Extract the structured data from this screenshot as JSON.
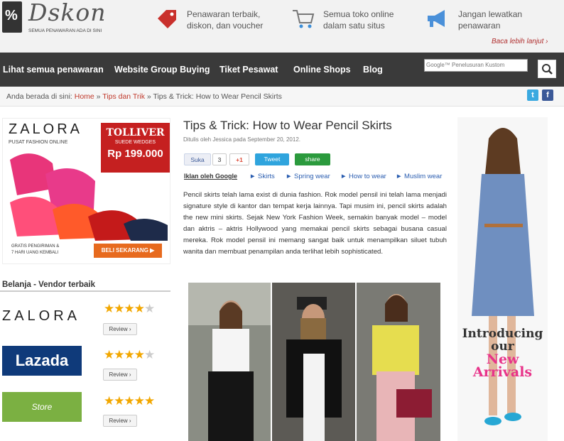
{
  "header": {
    "logo_mark": "%",
    "logo_text": "Dskon",
    "logo_tagline": "SEMUA PENAWARAN ADA DI SINI",
    "features": [
      {
        "line1": "Penawaran terbaik,",
        "line2": "diskon, dan voucher",
        "icon": "tag-icon"
      },
      {
        "line1": "Semua toko online",
        "line2": "dalam satu situs",
        "icon": "cart-icon"
      },
      {
        "line1": "Jangan lewatkan",
        "line2": "penawaran",
        "icon": "megaphone-icon"
      }
    ],
    "read_more": "Baca lebih lanjut ›"
  },
  "nav": {
    "items": [
      "Lihat semua penawaran",
      "Website Group Buying",
      "Tiket Pesawat",
      "Online Shops",
      "Blog"
    ],
    "search_placeholder": "Google™ Penelusuran Kustom"
  },
  "breadcrumb": {
    "prefix": "Anda berada di sini:",
    "home": "Home",
    "section": "Tips dan Trik",
    "current": "Tips & Trick: How to Wear Pencil Skirts"
  },
  "ad_left": {
    "brand": "ZALORA",
    "brand_sub": "PUSAT FASHION ONLINE",
    "product": "TOLLIVER",
    "product_sub": "SUEDE WEDGES",
    "price": "Rp 199.000",
    "foot1": "GRATIS PENGIRIMAN &",
    "foot2": "7 HARI UANG KEMBALI",
    "cta": "BELI SEKARANG ▶"
  },
  "vendors": {
    "heading": "Belanja - Vendor terbaik",
    "review_label": "Review ›",
    "items": [
      {
        "logo": "ZALORA",
        "stars": 4.5
      },
      {
        "logo": "Lazada",
        "stars": 4
      },
      {
        "logo": "Store",
        "stars": 5
      }
    ]
  },
  "article": {
    "title": "Tips & Trick: How to Wear Pencil Skirts",
    "meta": "Ditulis oleh Jessica pada September 20, 2012.",
    "share": {
      "like": "Suka",
      "like_count": "3",
      "plus": "+1",
      "tweet": "Tweet",
      "share": "share"
    },
    "ads_by": "Iklan oleh Google",
    "ad_links": [
      "Skirts",
      "Spring wear",
      "How to wear",
      "Muslim wear"
    ],
    "body": "Pencil skirts telah lama exist di dunia fashion. Rok model pensil ini telah lama menjadi signature style di kantor dan tempat kerja lainnya. Tapi musim ini, pencil skirts adalah the new mini skirts. Sejak New York Fashion Week, semakin banyak model – model dan aktris – aktris Hollywood yang memakai pencil skirts sebagai busana casual mereka. Rok model pensil ini memang sangat baik untuk menampilkan siluet tubuh wanita dan membuat penampilan anda terlihat lebih sophisticated."
  },
  "ad_right": {
    "line1": "Introducing",
    "line2": "our",
    "line3": "New",
    "line4": "Arrivals"
  }
}
